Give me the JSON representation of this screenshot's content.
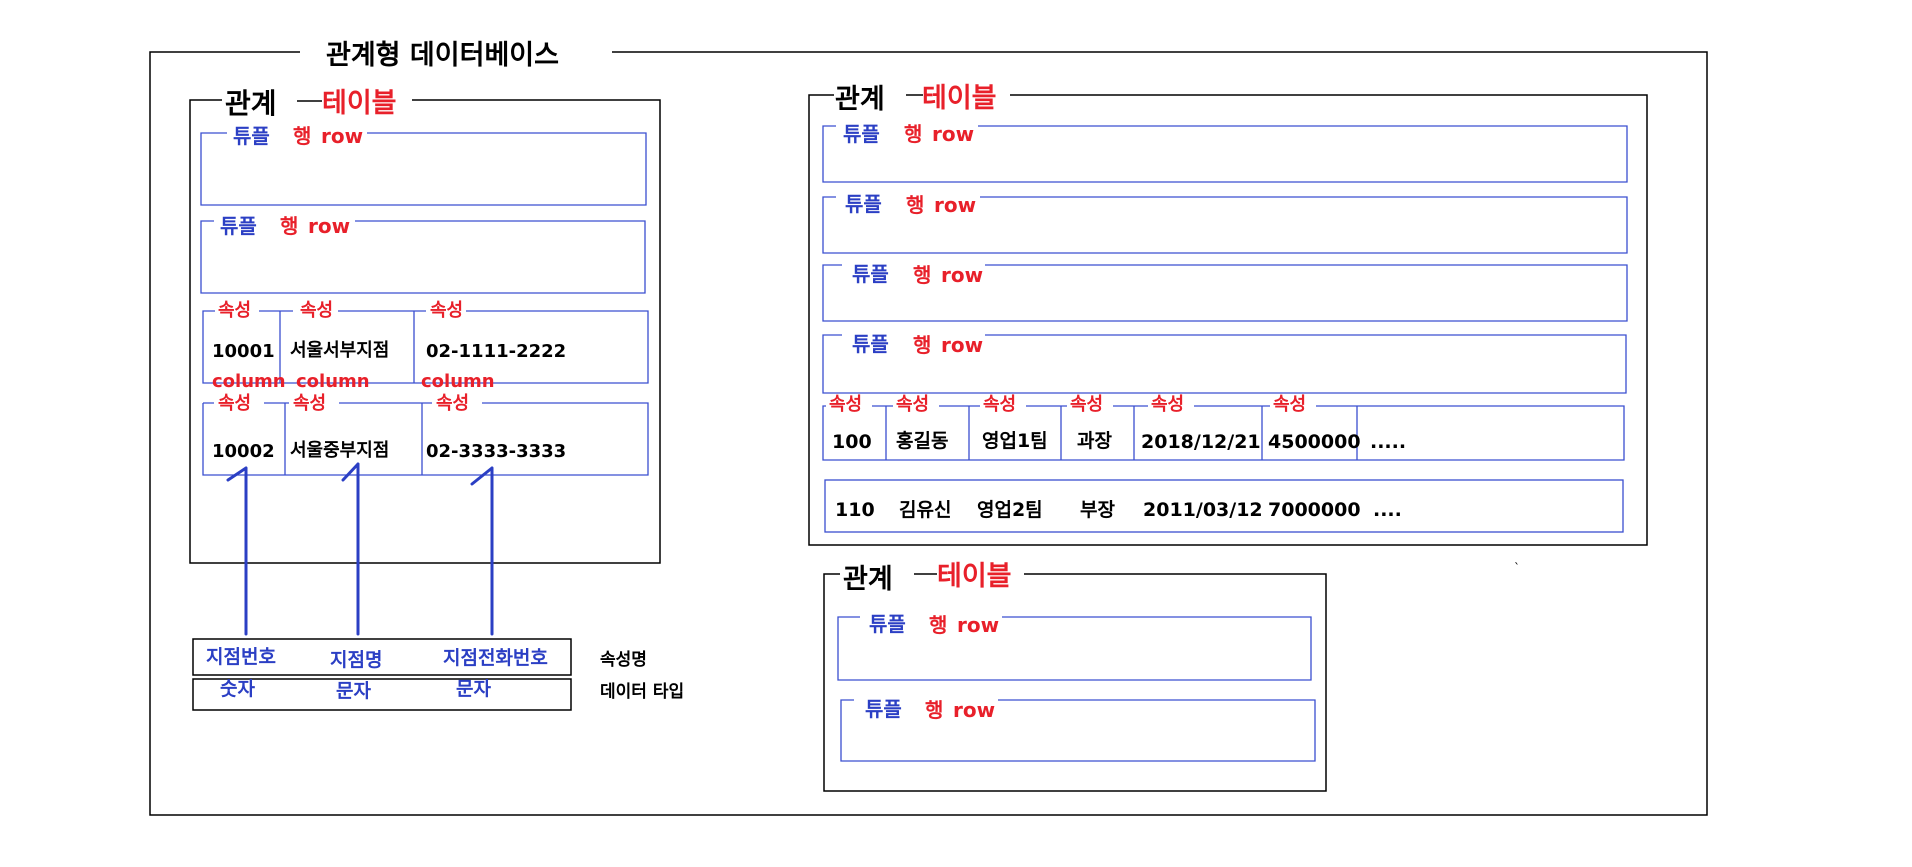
{
  "title": "관계형 데이터베이스",
  "colors": {
    "frame": "#000000",
    "tuple_border": "#3a4fd0",
    "red": "#e8202a",
    "blue": "#2b3fc4",
    "arrow": "#2b3fc4"
  },
  "labels": {
    "relation": "관계",
    "table": "테이블",
    "tuple": "튜플",
    "row_kr": "행",
    "row_en": "row",
    "attribute": "속성",
    "column": "column",
    "ellipsis": "....."
  },
  "left_rows": [
    [
      "10001",
      "서울서부지점",
      "02-1111-2222"
    ],
    [
      "10002",
      "서울중부지점",
      "02-3333-3333"
    ]
  ],
  "schema": {
    "names": [
      "지점번호",
      "지점명",
      "지점전화번호"
    ],
    "types": [
      "숫자",
      "문자",
      "문자"
    ],
    "name_caption": "속성명",
    "type_caption": "데이터 타입"
  },
  "right_rows": [
    [
      "100",
      "홍길동",
      "영업1팀",
      "과장",
      "2018/12/21",
      "4500000"
    ],
    [
      "110",
      "김유신",
      "영업2팀",
      "부장",
      "2011/03/12",
      "7000000"
    ]
  ],
  "right_row2_ellipsis": "...."
}
